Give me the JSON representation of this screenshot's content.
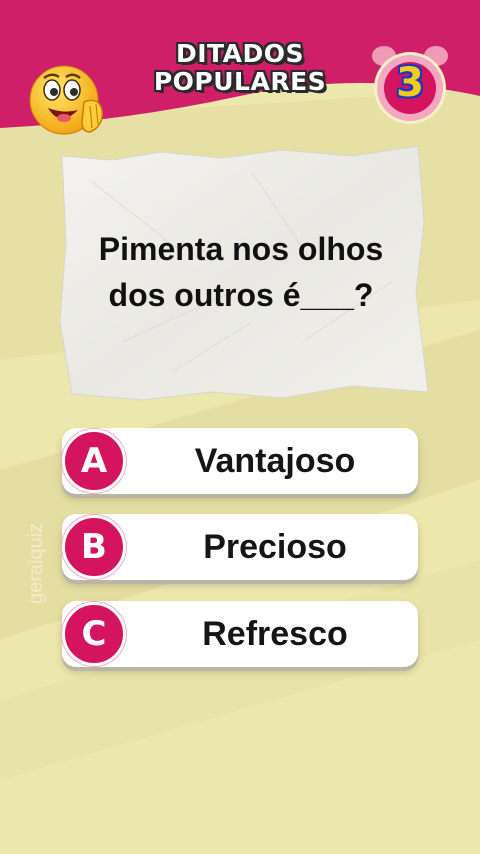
{
  "header": {
    "title_line1": "DITADOS",
    "title_line2": "POPULARES",
    "timer_value": "3",
    "emoji_icon": "winking-whisper-emoji-icon",
    "timer_icon": "alarm-clock-icon"
  },
  "question": {
    "line1": "Pimenta nos olhos",
    "line2": "dos outros é___?"
  },
  "answers": [
    {
      "letter": "A",
      "text": "Vantajoso"
    },
    {
      "letter": "B",
      "text": "Precioso"
    },
    {
      "letter": "C",
      "text": "Refresco"
    }
  ],
  "watermark": "geraiquiz",
  "colors": {
    "header_magenta": "#cf1f68",
    "background_yellow": "#ece7ad",
    "badge_pink": "#d4145e",
    "timer_blue": "#1b37c9",
    "timer_yellow": "#f1cc1a"
  }
}
